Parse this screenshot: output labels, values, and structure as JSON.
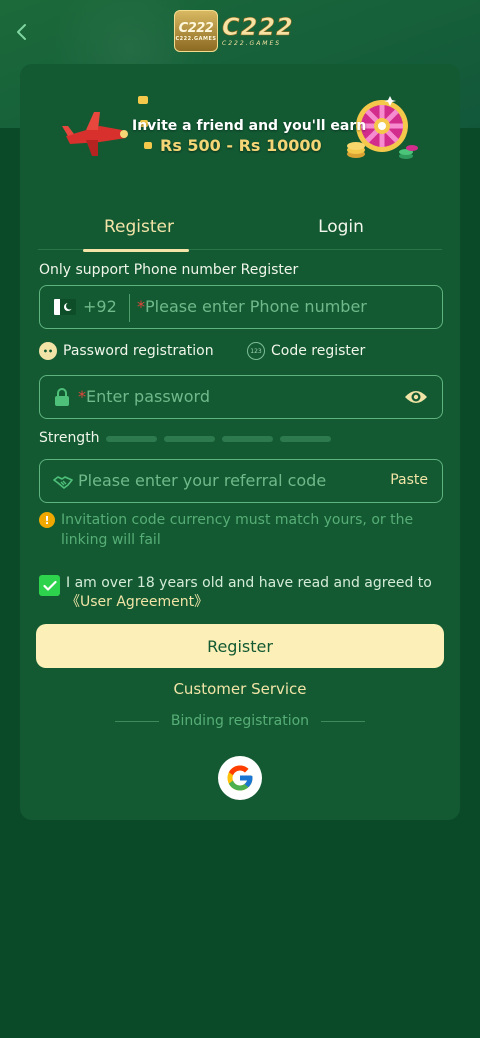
{
  "header": {
    "logo_box_text": "C222",
    "logo_box_sub": "C222.GAMES",
    "logo_text": "C222",
    "logo_sub": "C222.GAMES"
  },
  "banner": {
    "line1": "Invite a friend and you'll earn",
    "line2": "Rs 500 - Rs 10000"
  },
  "tabs": [
    {
      "label": "Register",
      "active": true
    },
    {
      "label": "Login",
      "active": false
    }
  ],
  "form": {
    "phone_label": "Only support Phone number Register",
    "country_code": "+92",
    "phone_required_mark": "*",
    "phone_placeholder": "Please enter Phone number",
    "option_password": "Password registration",
    "option_code": "Code register",
    "option_code_icon_text": "123",
    "password_required_mark": "*",
    "password_placeholder": "Enter password",
    "strength_label": "Strength",
    "strength_level": 0,
    "strength_segments": 4,
    "referral_placeholder": "Please enter your referral code",
    "paste_label": "Paste",
    "warning_text": "Invitation code currency must match yours, or the linking will fail",
    "warning_icon_text": "!",
    "agree_checked": true,
    "agree_text": "I am over 18 years old and have read and agreed to",
    "agree_link": "《User Agreement》"
  },
  "actions": {
    "register_label": "Register",
    "customer_service": "Customer Service",
    "binding_label": "Binding registration"
  },
  "colors": {
    "background": "#0b4a28",
    "card": "#135a33",
    "accent": "#f1e4a6",
    "button": "#fcefb7",
    "field_border": "#5fb37f",
    "checkbox": "#2ed34d",
    "warning": "#f0a800"
  },
  "icons": [
    "back-chevron-icon",
    "pakistan-flag-icon",
    "lock-icon",
    "eye-icon",
    "handshake-icon",
    "warning-icon",
    "check-icon",
    "google-icon"
  ]
}
